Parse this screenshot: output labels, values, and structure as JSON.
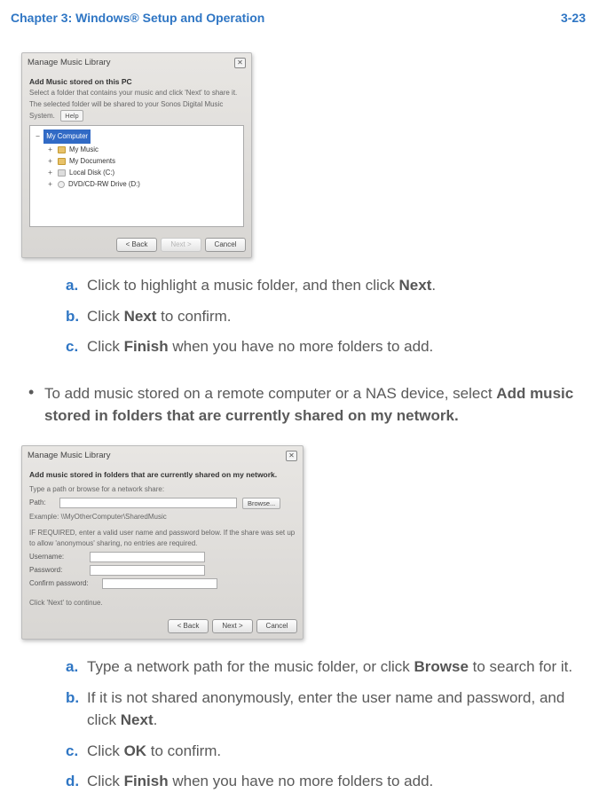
{
  "header": {
    "left": "Chapter 3:  Windows® Setup and Operation",
    "right": "3-23"
  },
  "dialog1": {
    "title": "Manage Music Library",
    "heading": "Add Music stored on this PC",
    "line1": "Select a folder that contains your music and click 'Next' to share it.",
    "line2": "The selected folder will be shared to your Sonos Digital Music System.",
    "help": "Help",
    "tree_root": "My Computer",
    "tree": [
      "My Music",
      "My Documents",
      "Local Disk (C:)",
      "DVD/CD-RW Drive (D:)"
    ],
    "btn_back": "< Back",
    "btn_next": "Next >",
    "btn_cancel": "Cancel"
  },
  "steps1": [
    {
      "letter": "a.",
      "parts": [
        "Click to highlight a music folder, and then click ",
        "Next",
        "."
      ]
    },
    {
      "letter": "b.",
      "parts": [
        "Click ",
        "Next",
        " to confirm."
      ]
    },
    {
      "letter": "c.",
      "parts": [
        "Click ",
        "Finish",
        " when you have no more folders to add."
      ]
    }
  ],
  "bullet": {
    "parts": [
      "To add music stored on a remote computer or a NAS device, select ",
      "Add music stored in folders that are currently shared on my network."
    ]
  },
  "dialog2": {
    "title": "Manage Music Library",
    "heading": "Add music stored in folders that are currently shared on my network.",
    "line1": "Type a path or browse for a network share:",
    "path_label": "Path:",
    "browse": "Browse...",
    "example": "Example: \\\\MyOtherComputer\\SharedMusic",
    "creds_text": "IF REQUIRED, enter a valid user name and password below.  If the share was set up to allow 'anonymous' sharing, no entries are required.",
    "username_label": "Username:",
    "password_label": "Password:",
    "confirm_label": "Confirm password:",
    "continue_text": "Click 'Next' to continue.",
    "btn_back": "< Back",
    "btn_next": "Next >",
    "btn_cancel": "Cancel"
  },
  "steps2": [
    {
      "letter": "a.",
      "parts": [
        "Type a network path for the music folder, or click ",
        "Browse",
        " to search for it."
      ]
    },
    {
      "letter": "b.",
      "parts": [
        "If it is not shared anonymously, enter the user name and password, and click ",
        "Next",
        "."
      ]
    },
    {
      "letter": "c.",
      "parts": [
        "Click ",
        "OK",
        " to confirm."
      ]
    },
    {
      "letter": "d.",
      "parts": [
        "Click ",
        "Finish",
        " when you have no more folders to add."
      ]
    }
  ]
}
